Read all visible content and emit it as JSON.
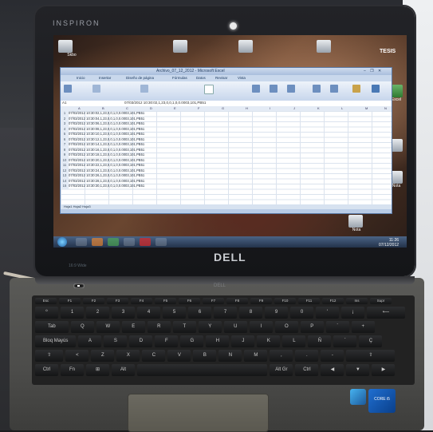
{
  "laptop": {
    "model_label": "INSPIRON",
    "brand_lid": "DELL",
    "brand_hinge": "DELL",
    "lid_label": "16:9 Wide"
  },
  "desktop": {
    "tesis_label": "TESIS",
    "icons": [
      "Skbo",
      "",
      "",
      "",
      "",
      ""
    ],
    "right_icons": [
      "Excel",
      "",
      "Nota",
      "Nota"
    ]
  },
  "excel": {
    "title": "Archivo_07_12_2012 - Microsoft Excel",
    "controls": "– ❐ ✕",
    "tabs": [
      "Inicio",
      "Insertar",
      "Diseño de página",
      "Fórmulas",
      "Datos",
      "Revisar",
      "Vista"
    ],
    "name_box": "A1",
    "formula": "07/03/2012 10:30:02,1,23,0,0,1,0,0.0003,101,PB51",
    "columns": [
      "A",
      "B",
      "C",
      "D",
      "E",
      "F",
      "G",
      "H",
      "I",
      "J",
      "K",
      "L",
      "M",
      "N"
    ],
    "rows": [
      "07/03/2012 10:30:02,1,23,0,0,1,0,0.0003,101,PB51",
      "07/03/2012 10:30:04,1,23,0,0,1,0,0.0003,101,PB51",
      "07/03/2012 10:30:06,1,23,0,0,1,0,0.0003,101,PB51",
      "07/03/2012 10:30:08,1,23,0,0,1,0,0.0003,101,PB51",
      "07/03/2012 10:30:10,1,23,0,0,1,0,0.0003,101,PB51",
      "07/03/2012 10:30:12,1,23,0,0,1,0,0.0003,101,PB51",
      "07/03/2012 10:30:14,1,23,0,0,1,0,0.0003,101,PB51",
      "07/03/2012 10:30:16,1,23,0,0,1,0,0.0003,101,PB51",
      "07/03/2012 10:30:18,1,23,0,0,1,0,0.0003,101,PB51",
      "07/03/2012 10:30:20,1,23,0,0,1,0,0.0003,101,PB51",
      "07/03/2012 10:30:22,1,23,0,0,1,0,0.0003,101,PB51",
      "07/03/2012 10:30:24,1,23,0,0,1,0,0.0003,101,PB51",
      "07/03/2012 10:30:26,1,23,0,0,1,0,0.0003,101,PB51",
      "07/03/2012 10:30:28,1,23,0,0,1,0,0.0003,101,PB51",
      "07/03/2012 10:30:30,1,23,0,0,1,0,0.0003,101,PB51"
    ],
    "sheet_tabs": "Hoja1  Hoja2  Hoja3"
  },
  "taskbar": {
    "clock": "11:26\n07/12/2012",
    "apps": [
      "file-explorer-icon",
      "media-player-icon",
      "excel-icon",
      "folder-icon",
      "pdf-icon",
      "window-icon"
    ]
  },
  "keyboard": {
    "row1": [
      "Esc",
      "F1",
      "F2",
      "F3",
      "F4",
      "F5",
      "F6",
      "F7",
      "F8",
      "F9",
      "F10",
      "F11",
      "F12",
      "Ins",
      "Supr"
    ],
    "row2": [
      "º",
      "1",
      "2",
      "3",
      "4",
      "5",
      "6",
      "7",
      "8",
      "9",
      "0",
      "'",
      "¡",
      "⟵"
    ],
    "row3": [
      "Tab",
      "Q",
      "W",
      "E",
      "R",
      "T",
      "Y",
      "U",
      "I",
      "O",
      "P",
      "`",
      "+"
    ],
    "row4": [
      "Bloq Mayús",
      "A",
      "S",
      "D",
      "F",
      "G",
      "H",
      "J",
      "K",
      "L",
      "Ñ",
      "´",
      "Ç"
    ],
    "row5": [
      "⇧",
      "<",
      "Z",
      "X",
      "C",
      "V",
      "B",
      "N",
      "M",
      ",",
      ".",
      "-",
      "⇧"
    ],
    "row6": [
      "Ctrl",
      "Fn",
      "⊞",
      "Alt",
      "",
      "Alt Gr",
      "Ctrl",
      "◀",
      "▼",
      "▶"
    ]
  },
  "stickers": {
    "intel": "CORE i5"
  }
}
